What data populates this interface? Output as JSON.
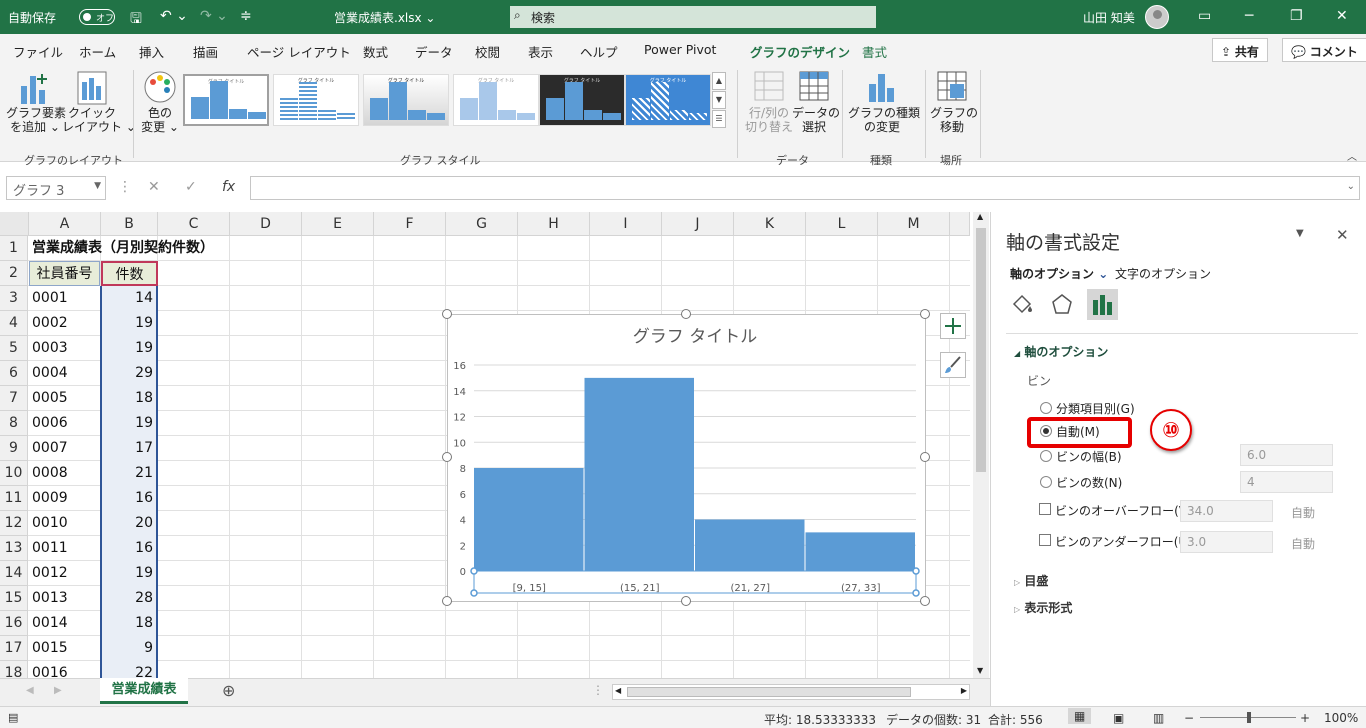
{
  "titlebar": {
    "autosave_label": "自動保存",
    "autosave_state": "オフ",
    "filename": "営業成績表.xlsx",
    "search_placeholder": "検索",
    "user": "山田 知美"
  },
  "tabs": [
    "ファイル",
    "ホーム",
    "挿入",
    "描画",
    "ページ レイアウト",
    "数式",
    "データ",
    "校閲",
    "表示",
    "ヘルプ",
    "Power Pivot",
    "グラフのデザイン",
    "書式"
  ],
  "share_label": "共有",
  "comment_label": "コメント",
  "ribbon": {
    "add_element": [
      "グラフ要素",
      "を追加 ⌄"
    ],
    "quick_layout": [
      "クイック",
      "レイアウト ⌄"
    ],
    "group_layout": "グラフのレイアウト",
    "change_color": [
      "色の",
      "変更 ⌄"
    ],
    "group_styles": "グラフ スタイル",
    "switch_rowcol": [
      "行/列の",
      "切り替え"
    ],
    "select_data": [
      "データの",
      "選択"
    ],
    "group_data": "データ",
    "change_type": [
      "グラフの種類",
      "の変更"
    ],
    "group_type": "種類",
    "move_chart": [
      "グラフの",
      "移動"
    ],
    "group_location": "場所",
    "thumb_titles": [
      "グラフ タイトル",
      "グラフ タイトル",
      "グラフ タイトル",
      "グラフ タイトル",
      "グラフ タイトル",
      "グラフ タイトル"
    ]
  },
  "formula_bar": {
    "name_box": "グラフ 3",
    "fx": "fx",
    "formula": ""
  },
  "sheet": {
    "columns": [
      "A",
      "B",
      "C",
      "D",
      "E",
      "F",
      "G",
      "H",
      "I",
      "J",
      "K",
      "L",
      "M"
    ],
    "rows": [
      "1",
      "2",
      "3",
      "4",
      "5",
      "6",
      "7",
      "8",
      "9",
      "10",
      "11",
      "12",
      "13",
      "14",
      "15",
      "16",
      "17",
      "18"
    ],
    "title": "営業成績表（月別契約件数）",
    "headers": [
      "社員番号",
      "件数"
    ],
    "data": [
      [
        "0001",
        "14"
      ],
      [
        "0002",
        "19"
      ],
      [
        "0003",
        "19"
      ],
      [
        "0004",
        "29"
      ],
      [
        "0005",
        "18"
      ],
      [
        "0006",
        "19"
      ],
      [
        "0007",
        "17"
      ],
      [
        "0008",
        "21"
      ],
      [
        "0009",
        "16"
      ],
      [
        "0010",
        "20"
      ],
      [
        "0011",
        "16"
      ],
      [
        "0012",
        "19"
      ],
      [
        "0013",
        "28"
      ],
      [
        "0014",
        "18"
      ],
      [
        "0015",
        "9"
      ],
      [
        "0016",
        "22"
      ]
    ],
    "tab_name": "営業成績表"
  },
  "chart_data": {
    "type": "bar",
    "title": "グラフ タイトル",
    "categories": [
      "[9, 15]",
      "(15, 21]",
      "(21, 27]",
      "(27, 33]"
    ],
    "values": [
      8,
      15,
      4,
      3
    ],
    "yticks": [
      "0",
      "2",
      "4",
      "6",
      "8",
      "10",
      "12",
      "14",
      "16"
    ],
    "ylim": [
      0,
      16
    ],
    "grid": true,
    "color": "#5b9bd5"
  },
  "pane": {
    "title": "軸の書式設定",
    "tab_axis": "軸のオプション",
    "tab_text": "文字のオプション",
    "section": "軸のオプション",
    "bin_label": "ビン",
    "opt_category": "分類項目別(G)",
    "opt_auto": "自動(M)",
    "opt_width": "ビンの幅(B)",
    "opt_count": "ビンの数(N)",
    "width_value": "6.0",
    "count_value": "4",
    "overflow": "ビンのオーバーフロー(V)",
    "overflow_value": "34.0",
    "underflow": "ビンのアンダーフロー(U)",
    "underflow_value": "3.0",
    "auto_label": "自動",
    "ticks": "目盛",
    "format": "表示形式",
    "step_badge": "⑩"
  },
  "status": {
    "average": "平均: 18.53333333",
    "count": "データの個数: 31",
    "sum": "合計: 556",
    "zoom": "100%"
  },
  "accent": "#217346"
}
